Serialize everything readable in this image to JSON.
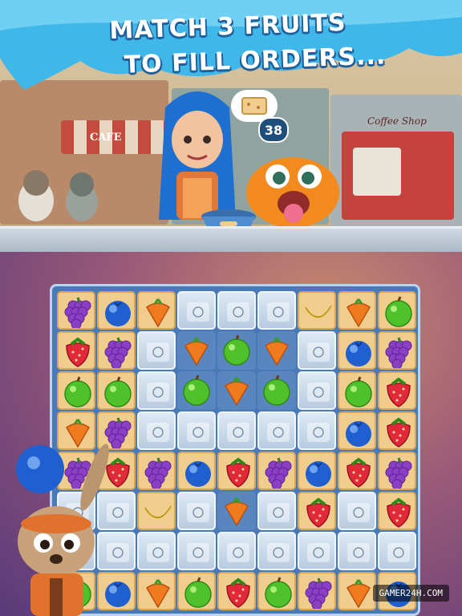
{
  "banner": {
    "line1": "MATCH 3 FRUITS",
    "line2": "TO FILL ORDERS..."
  },
  "order_counter": "38",
  "shops": {
    "left_sign": "CAFE",
    "right_sign": "Coffee Shop"
  },
  "watermark": "GAMER24H.COM",
  "board": {
    "rows": 8,
    "cols": 9,
    "grid": [
      [
        {
          "t": "cookie",
          "f": "grape"
        },
        {
          "t": "cookie",
          "f": "blueberry"
        },
        {
          "t": "cookie",
          "f": "carrot"
        },
        {
          "t": "ice",
          "f": ""
        },
        {
          "t": "ice",
          "f": ""
        },
        {
          "t": "ice",
          "f": ""
        },
        {
          "t": "cookie",
          "f": "banana"
        },
        {
          "t": "cookie",
          "f": "carrot"
        },
        {
          "t": "cookie",
          "f": "apple"
        }
      ],
      [
        {
          "t": "cookie",
          "f": "strawberry"
        },
        {
          "t": "cookie",
          "f": "grape"
        },
        {
          "t": "ice",
          "f": ""
        },
        {
          "t": "dark",
          "f": "carrot"
        },
        {
          "t": "dark",
          "f": "apple"
        },
        {
          "t": "dark",
          "f": "carrot"
        },
        {
          "t": "ice",
          "f": ""
        },
        {
          "t": "cookie",
          "f": "blueberry"
        },
        {
          "t": "cookie",
          "f": "grape"
        }
      ],
      [
        {
          "t": "cookie",
          "f": "apple"
        },
        {
          "t": "cookie",
          "f": "apple"
        },
        {
          "t": "ice",
          "f": ""
        },
        {
          "t": "dark",
          "f": "apple"
        },
        {
          "t": "dark",
          "f": "carrot"
        },
        {
          "t": "dark",
          "f": "apple"
        },
        {
          "t": "ice",
          "f": ""
        },
        {
          "t": "cookie",
          "f": "apple"
        },
        {
          "t": "cookie",
          "f": "strawberry"
        }
      ],
      [
        {
          "t": "cookie",
          "f": "carrot"
        },
        {
          "t": "cookie",
          "f": "grape"
        },
        {
          "t": "ice",
          "f": ""
        },
        {
          "t": "ice",
          "f": ""
        },
        {
          "t": "ice",
          "f": ""
        },
        {
          "t": "ice",
          "f": ""
        },
        {
          "t": "ice",
          "f": ""
        },
        {
          "t": "cookie",
          "f": "blueberry"
        },
        {
          "t": "cookie",
          "f": "strawberry"
        }
      ],
      [
        {
          "t": "cookie",
          "f": "grape"
        },
        {
          "t": "cookie",
          "f": "strawberry"
        },
        {
          "t": "cookie",
          "f": "grape"
        },
        {
          "t": "cookie",
          "f": "blueberry"
        },
        {
          "t": "cookie",
          "f": "strawberry"
        },
        {
          "t": "cookie",
          "f": "grape"
        },
        {
          "t": "cookie",
          "f": "blueberry"
        },
        {
          "t": "cookie",
          "f": "strawberry"
        },
        {
          "t": "cookie",
          "f": "grape"
        }
      ],
      [
        {
          "t": "ice",
          "f": ""
        },
        {
          "t": "ice",
          "f": ""
        },
        {
          "t": "cookie",
          "f": "banana"
        },
        {
          "t": "ice",
          "f": ""
        },
        {
          "t": "dark",
          "f": "carrot"
        },
        {
          "t": "ice",
          "f": ""
        },
        {
          "t": "cookie",
          "f": "strawberry"
        },
        {
          "t": "ice",
          "f": ""
        },
        {
          "t": "cookie",
          "f": "strawberry"
        }
      ],
      [
        {
          "t": "ice",
          "f": ""
        },
        {
          "t": "ice",
          "f": ""
        },
        {
          "t": "ice",
          "f": ""
        },
        {
          "t": "ice",
          "f": ""
        },
        {
          "t": "ice",
          "f": ""
        },
        {
          "t": "ice",
          "f": ""
        },
        {
          "t": "ice",
          "f": ""
        },
        {
          "t": "ice",
          "f": ""
        },
        {
          "t": "ice",
          "f": ""
        }
      ],
      [
        {
          "t": "cookie",
          "f": "apple"
        },
        {
          "t": "cookie",
          "f": "blueberry"
        },
        {
          "t": "cookie",
          "f": "carrot"
        },
        {
          "t": "cookie",
          "f": "apple"
        },
        {
          "t": "cookie",
          "f": "strawberry"
        },
        {
          "t": "cookie",
          "f": "apple"
        },
        {
          "t": "cookie",
          "f": "grape"
        },
        {
          "t": "cookie",
          "f": "carrot"
        },
        {
          "t": "cookie",
          "f": "blueberry"
        }
      ]
    ]
  },
  "colors": {
    "banner_blue": "#3fb7e8",
    "board_blue": "#4a79b8"
  }
}
